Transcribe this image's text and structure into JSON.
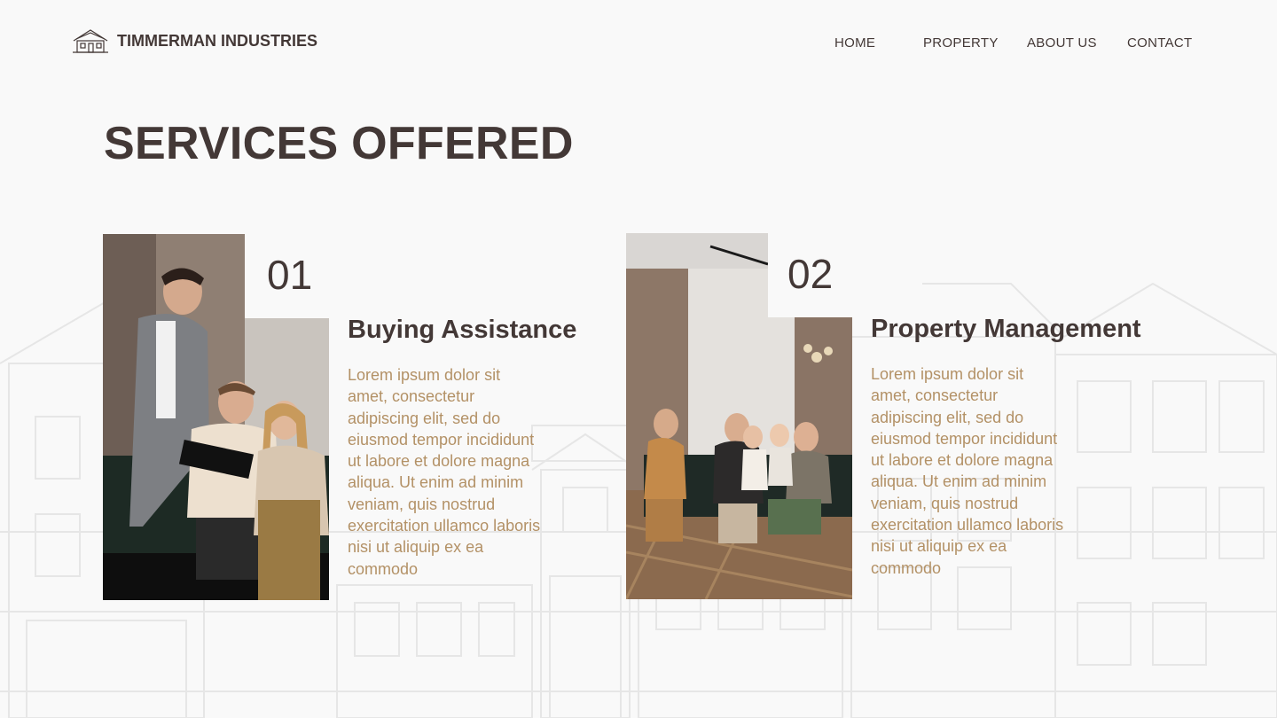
{
  "brand": {
    "name": "TIMMERMAN INDUSTRIES",
    "logo_icon": "house-logo-icon"
  },
  "nav": {
    "items": [
      "HOME",
      "PROPERTY",
      "ABOUT US",
      "CONTACT"
    ]
  },
  "section": {
    "title": "SERVICES OFFERED"
  },
  "services": [
    {
      "number": "01",
      "title": "Buying Assistance",
      "text": "Lorem ipsum dolor sit amet, consectetur adipiscing elit, sed do eiusmod tempor incididunt ut labore et dolore magna aliqua. Ut enim ad minim veniam, quis nostrud exercitation ullamco laboris nisi ut aliquip ex ea commodo",
      "photo": "agent-showing-document-to-couple-photo"
    },
    {
      "number": "02",
      "title": "Property Management",
      "text": "Lorem ipsum dolor sit amet, consectetur adipiscing elit, sed do eiusmod tempor incididunt ut labore et dolore magna aliqua. Ut enim ad minim veniam, quis nostrud exercitation ullamco laboris nisi ut aliquip ex ea commodo",
      "photo": "family-with-agent-on-sofa-photo"
    }
  ],
  "colors": {
    "primary_text": "#433836",
    "accent_text": "#b39166",
    "background": "#f9f9f9"
  }
}
